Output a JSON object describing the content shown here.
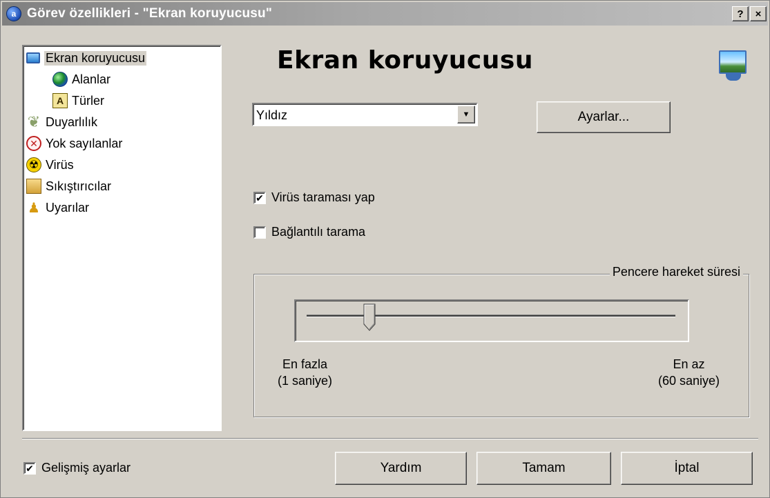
{
  "window": {
    "title": "Görev özellikleri - \"Ekran koruyucusu\"",
    "help_button": "?",
    "close_button": "×"
  },
  "tree": {
    "items": [
      {
        "label": "Ekran koruyucusu",
        "icon": "monitor-icon",
        "selected": true
      },
      {
        "label": "Alanlar",
        "icon": "globe-icon"
      },
      {
        "label": "Türler",
        "icon": "font-icon"
      },
      {
        "label": "Duyarlılık",
        "icon": "feather-icon"
      },
      {
        "label": "Yok sayılanlar",
        "icon": "red-x-icon"
      },
      {
        "label": "Virüs",
        "icon": "radiation-icon"
      },
      {
        "label": "Sıkıştırıcılar",
        "icon": "box-icon"
      },
      {
        "label": "Uyarılar",
        "icon": "user-icon"
      }
    ]
  },
  "main": {
    "heading": "Ekran koruyucusu",
    "screensaver_select": {
      "value": "Yıldız"
    },
    "settings_button": "Ayarlar...",
    "virus_scan_checkbox": {
      "label": "Virüs taraması yap",
      "checked": true
    },
    "linked_scan_checkbox": {
      "label": "Bağlantılı tarama",
      "checked": false
    },
    "group": {
      "title": "Pencere hareket süresi",
      "slider_fraction": 0.17,
      "left_label": "En fazla",
      "left_sub": "(1 saniye)",
      "right_label": "En az",
      "right_sub": "(60 saniye)"
    }
  },
  "footer": {
    "advanced_checkbox": {
      "label": "Gelişmiş ayarlar",
      "checked": true
    },
    "help_button": "Yardım",
    "ok_button": "Tamam",
    "cancel_button": "İptal"
  },
  "colors": {
    "window_bg": "#d4d0c8",
    "title_gradient_start": "#808080",
    "title_text": "#ffffff"
  }
}
